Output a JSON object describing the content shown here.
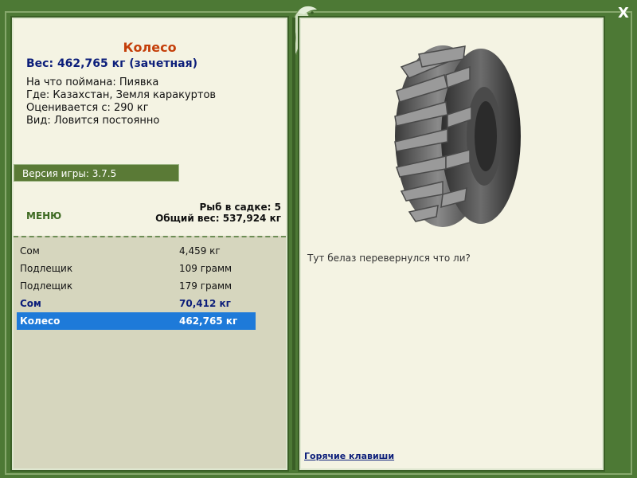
{
  "window": {
    "close_label": "X"
  },
  "fish": {
    "title": "Колесо",
    "weight": "Вес: 462,765 кг (зачетная)",
    "caught_on": "На что поймана: Пиявка",
    "where": "Где: Казахстан, Земля каракуртов",
    "valued_from": "Оценивается с: 290 кг",
    "kind": "Вид: Ловится постоянно",
    "image": "tire-image",
    "description": "Тут белаз перевернулся что ли?"
  },
  "game": {
    "version": "Версия игры: 3.7.5",
    "menu_label": "МЕНЮ"
  },
  "keepnet": {
    "count": "Рыб в садке: 5",
    "total_weight": "Общий вес: 537,924 кг",
    "items": [
      {
        "name": "Сом",
        "weight": "4,459 кг",
        "style": "normal"
      },
      {
        "name": "Подлещик",
        "weight": "109 грамм",
        "style": "normal"
      },
      {
        "name": "Подлещик",
        "weight": "179 грамм",
        "style": "normal"
      },
      {
        "name": "Сом",
        "weight": "70,412 кг",
        "style": "bold"
      },
      {
        "name": "Колесо",
        "weight": "462,765 кг",
        "style": "selected"
      }
    ]
  },
  "footer": {
    "hotkeys_label": "Горячие клавиши"
  },
  "colors": {
    "frame_green": "#4d7935",
    "panel_cream": "#f4f3e3",
    "list_bg": "#d6d6be",
    "selection_blue": "#1e7ad9",
    "title_orange": "#c43f0a",
    "navy": "#0c1e7a"
  }
}
